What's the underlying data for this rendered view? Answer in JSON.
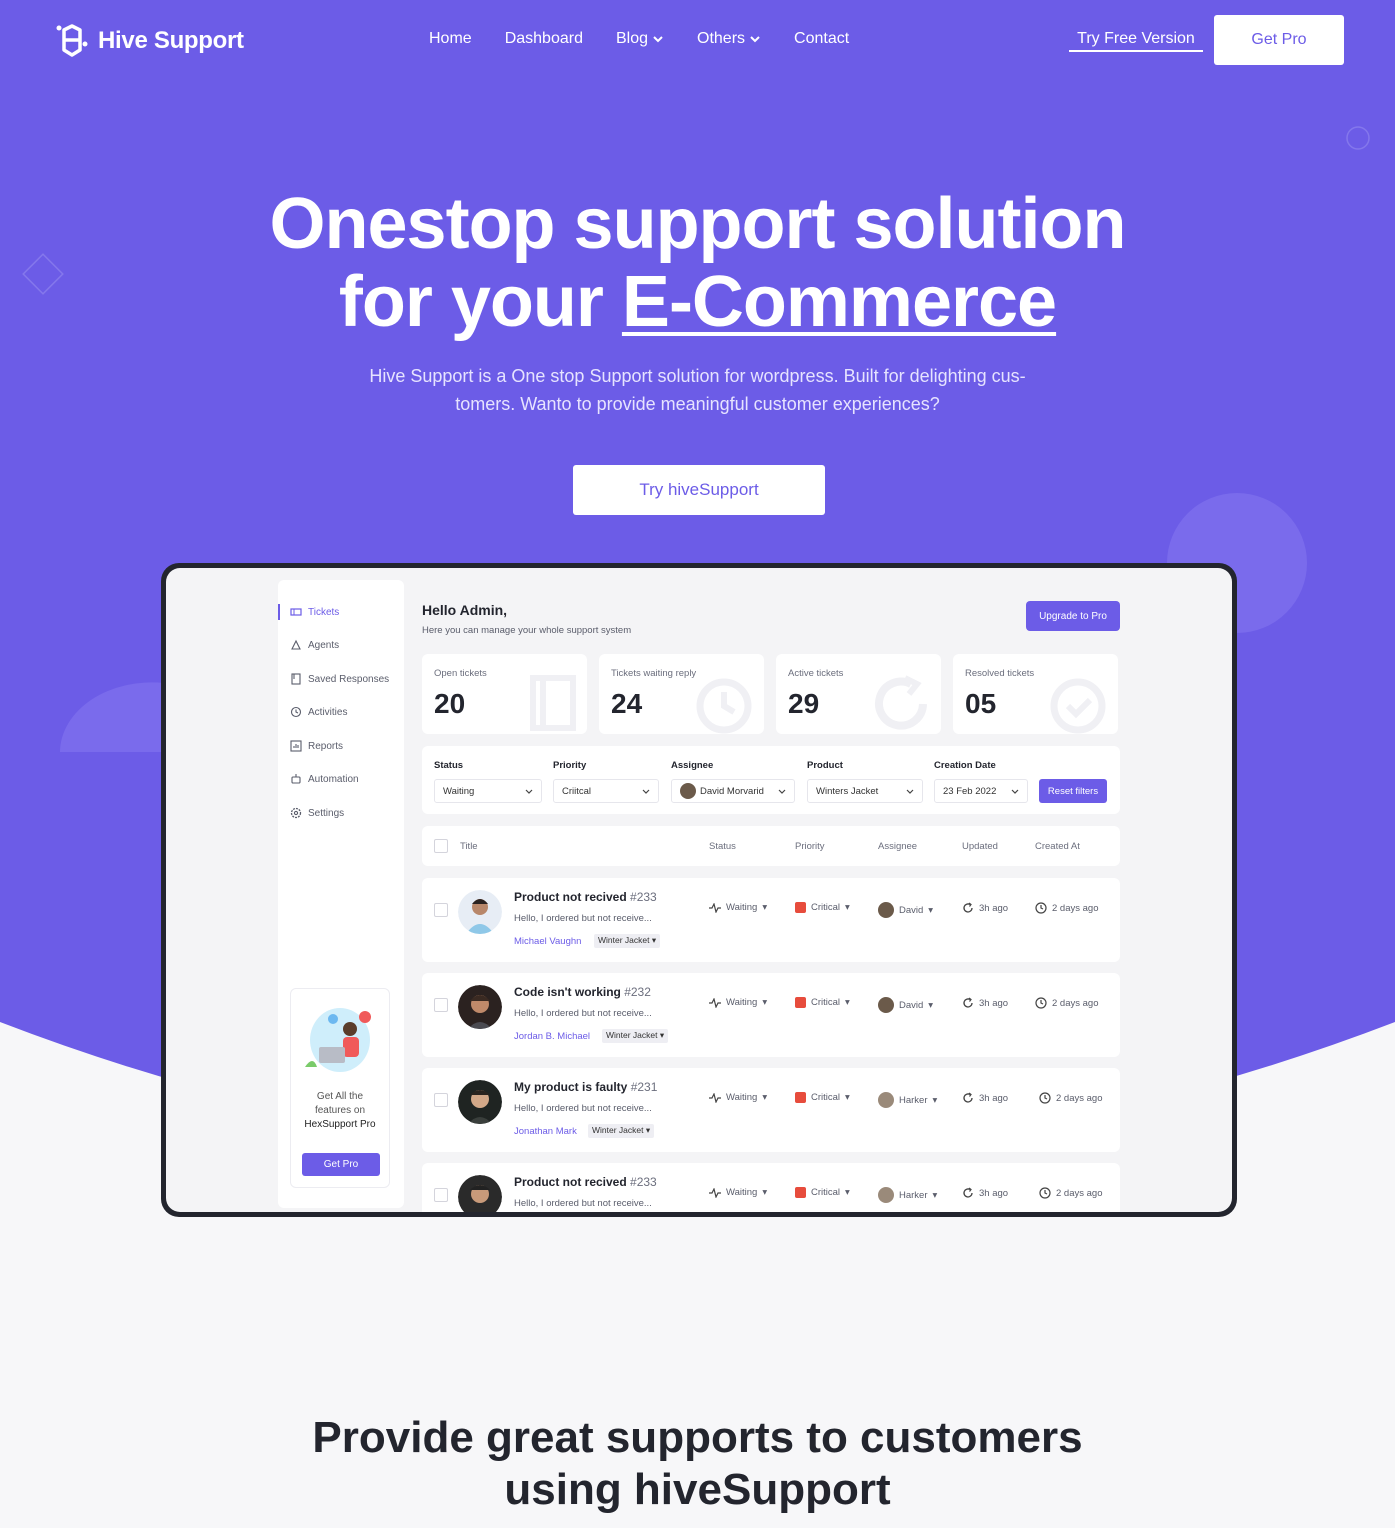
{
  "brand": {
    "name": "Hive Support",
    "accent": "#6c5ce7"
  },
  "nav": {
    "links": [
      "Home",
      "Dashboard",
      "Blog",
      "Others",
      "Contact"
    ],
    "try_free": "Try Free Version",
    "get_pro": "Get Pro"
  },
  "hero": {
    "title_line1": "Onestop support solution",
    "title_line2_prefix": "for your ",
    "title_line2_highlight": "E-Commerce",
    "subtitle_line1": "Hive Support is a One stop Support solution for wordpress. Built for delighting cus-",
    "subtitle_line2": "tomers. Wanto to provide meaningful customer experiences?",
    "cta": "Try hiveSupport"
  },
  "dashboard": {
    "sidebar": {
      "items": [
        {
          "label": "Tickets",
          "icon": "ticket-icon"
        },
        {
          "label": "Agents",
          "icon": "agents-icon"
        },
        {
          "label": "Saved Responses",
          "icon": "saved-responses-icon"
        },
        {
          "label": "Activities",
          "icon": "activities-icon"
        },
        {
          "label": "Reports",
          "icon": "reports-icon"
        },
        {
          "label": "Automation",
          "icon": "automation-icon"
        },
        {
          "label": "Settings",
          "icon": "settings-icon"
        }
      ],
      "promo_line1": "Get All the",
      "promo_line2": "features on",
      "promo_line3": "HexSupport Pro",
      "promo_button": "Get Pro"
    },
    "greeting": "Hello Admin,",
    "greeting_sub": "Here you can manage your whole support system",
    "upgrade": "Upgrade to Pro",
    "stats": [
      {
        "label": "Open tickets",
        "value": "20",
        "icon": "ticket-icon"
      },
      {
        "label": "Tickets waiting reply",
        "value": "24",
        "icon": "clock-icon"
      },
      {
        "label": "Active tickets",
        "value": "29",
        "icon": "refresh-icon"
      },
      {
        "label": "Resolved tickets",
        "value": "05",
        "icon": "check-circle-icon"
      }
    ],
    "filters": {
      "status_label": "Status",
      "status_value": "Waiting",
      "priority_label": "Priority",
      "priority_value": "Criitcal",
      "assignee_label": "Assignee",
      "assignee_value": "David Morvarid",
      "product_label": "Product",
      "product_value": "Winters Jacket",
      "date_label": "Creation Date",
      "date_value": "23 Feb 2022",
      "reset": "Reset filters"
    },
    "table_headers": [
      "Title",
      "Status",
      "Priority",
      "Assignee",
      "Updated",
      "Created At"
    ],
    "tickets": [
      {
        "title": "Product not recived",
        "num": "#233",
        "msg": "Hello, I ordered but not receive...",
        "user": "Michael Vaughn",
        "tag": "Winter Jacket",
        "status": "Waiting",
        "priority": "Critical",
        "assignee": "David",
        "updated": "3h ago",
        "created": "2 days ago"
      },
      {
        "title": "Code isn't working",
        "num": "#232",
        "msg": "Hello, I ordered but not receive...",
        "user": "Jordan B. Michael",
        "tag": "Winter Jacket",
        "status": "Waiting",
        "priority": "Critical",
        "assignee": "David",
        "updated": "3h ago",
        "created": "2 days ago"
      },
      {
        "title": "My product is faulty",
        "num": "#231",
        "msg": "Hello, I ordered but not receive...",
        "user": "Jonathan Mark",
        "tag": "Winter Jacket",
        "status": "Waiting",
        "priority": "Critical",
        "assignee": "Harker",
        "updated": "3h ago",
        "created": "2 days ago"
      },
      {
        "title": "Product not recived",
        "num": "#233",
        "msg": "Hello, I ordered but not receive...",
        "user": "",
        "tag": "",
        "status": "Waiting",
        "priority": "Critical",
        "assignee": "Harker",
        "updated": "3h ago",
        "created": "2 days ago"
      }
    ]
  },
  "section2": {
    "title_line1": "Provide great supports to customers",
    "title_line2": "using hiveSupport"
  }
}
